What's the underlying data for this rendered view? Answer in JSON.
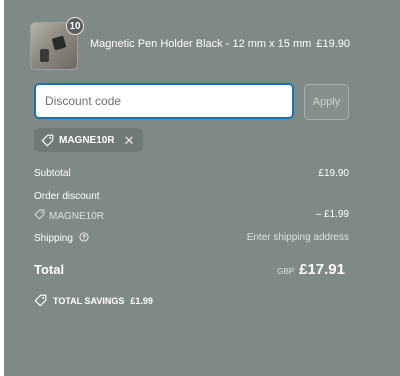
{
  "line_item": {
    "quantity": "10",
    "name": "Magnetic Pen Holder Black - 12 mm x 15 mm",
    "price": "£19.90",
    "image_icon": "product-thumbnail"
  },
  "discount": {
    "placeholder": "Discount code",
    "value": "",
    "apply_label": "Apply",
    "applied_code": "MAGNE10R",
    "chip_icon": "tag-icon",
    "remove_icon": "close-icon"
  },
  "summary": {
    "subtotal_label": "Subtotal",
    "subtotal_value": "£19.90",
    "order_discount_label": "Order discount",
    "discount_code": "MAGNE10R",
    "discount_value": "– £1.99",
    "shipping_label": "Shipping",
    "shipping_value": "Enter shipping address",
    "shipping_info_icon": "info-icon"
  },
  "total": {
    "label": "Total",
    "currency": "GBP",
    "amount": "£17.91"
  },
  "savings": {
    "label": "TOTAL SAVINGS",
    "amount": "£1.99",
    "icon": "tag-icon"
  },
  "colors": {
    "panel_bg": "#7f8a87",
    "input_border_focus": "#1773b0",
    "text": "#ffffff"
  }
}
